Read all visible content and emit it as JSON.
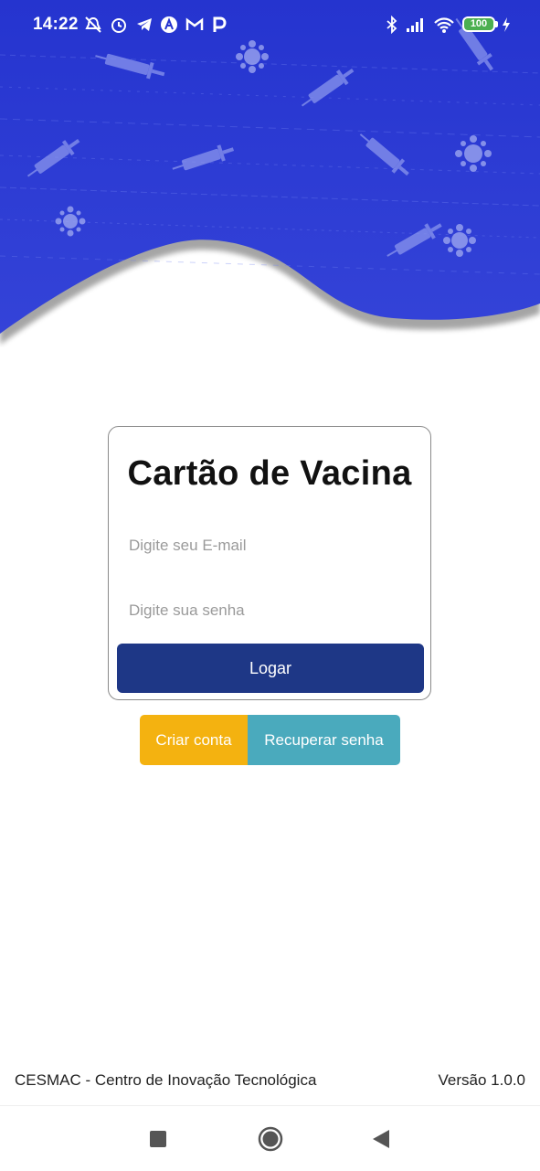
{
  "status_bar": {
    "time": "14:22",
    "battery": "100",
    "icons": [
      "alarm-off-icon",
      "alarm-icon",
      "telegram-icon",
      "a-app-icon",
      "mail-m-icon",
      "p-app-icon",
      "bluetooth-icon",
      "signal-icon",
      "wifi-icon",
      "battery-icon",
      "charging-icon"
    ]
  },
  "header": {
    "background_color": "#2838d4",
    "pattern_icons": [
      "syringe-icon",
      "virus-icon"
    ]
  },
  "login_card": {
    "title": "Cartão de Vacina",
    "email_placeholder": "Digite seu E-mail",
    "password_placeholder": "Digite sua senha",
    "login_label": "Logar"
  },
  "actions": {
    "create_account_label": "Criar conta",
    "recover_password_label": "Recuperar senha"
  },
  "footer": {
    "organization": "CESMAC - Centro de Inovação Tecnológica",
    "version": "Versão 1.0.0"
  },
  "navigation": {
    "icons": [
      "recents-square-icon",
      "home-circle-icon",
      "back-triangle-icon"
    ]
  },
  "colors": {
    "primary": "#1e3786",
    "header_blue": "#2838d4",
    "create_account": "#f4b210",
    "recover_password": "#4aaabd"
  }
}
